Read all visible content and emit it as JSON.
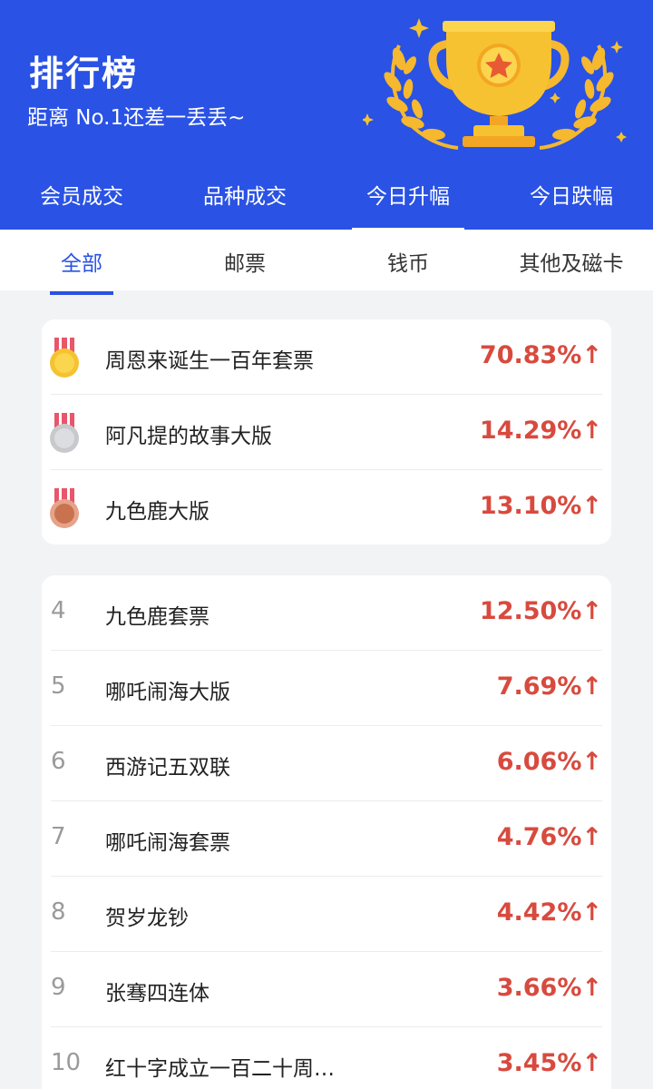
{
  "header": {
    "title": "排行榜",
    "subtitle": "距离 No.1还差一丢丢~"
  },
  "main_tabs": [
    {
      "label": "会员成交"
    },
    {
      "label": "品种成交"
    },
    {
      "label": "今日升幅",
      "active": true
    },
    {
      "label": "今日跌幅"
    }
  ],
  "sub_tabs": [
    {
      "label": "全部",
      "active": true
    },
    {
      "label": "邮票"
    },
    {
      "label": "钱币"
    },
    {
      "label": "其他及磁卡"
    }
  ],
  "top_three": [
    {
      "medal": "gold-medal-icon",
      "name": "周恩来诞生一百年套票",
      "change": "70.83%↑"
    },
    {
      "medal": "silver-medal-icon",
      "name": "阿凡提的故事大版",
      "change": "14.29%↑"
    },
    {
      "medal": "bronze-medal-icon",
      "name": "九色鹿大版",
      "change": "13.10%↑"
    }
  ],
  "ranking": [
    {
      "rank": "4",
      "name": "九色鹿套票",
      "change": "12.50%↑"
    },
    {
      "rank": "5",
      "name": "哪吒闹海大版",
      "change": "7.69%↑"
    },
    {
      "rank": "6",
      "name": "西游记五双联",
      "change": "6.06%↑"
    },
    {
      "rank": "7",
      "name": "哪吒闹海套票",
      "change": "4.76%↑"
    },
    {
      "rank": "8",
      "name": "贺岁龙钞",
      "change": "4.42%↑"
    },
    {
      "rank": "9",
      "name": "张骞四连体",
      "change": "3.66%↑"
    },
    {
      "rank": "10",
      "name": "红十字成立一百二十周…",
      "change": "3.45%↑"
    }
  ],
  "colors": {
    "header_bg": "#2a52e4",
    "accent": "#2a52e4",
    "rise": "#d84a3e",
    "gold": "#f5c230",
    "silver": "#c7c9cc",
    "bronze": "#d88a6a"
  }
}
